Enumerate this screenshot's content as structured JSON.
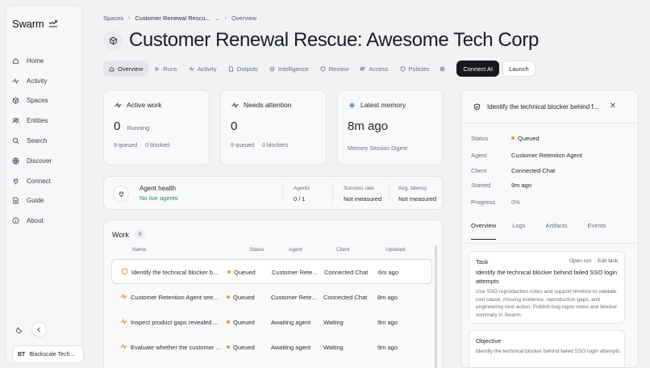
{
  "sidebar": {
    "brand": "Swarm",
    "items": [
      {
        "label": "Home",
        "icon": "home-icon"
      },
      {
        "label": "Activity",
        "icon": "activity-icon"
      },
      {
        "label": "Spaces",
        "icon": "cube-icon"
      },
      {
        "label": "Entities",
        "icon": "users-icon"
      },
      {
        "label": "Search",
        "icon": "search-icon"
      },
      {
        "label": "Discover",
        "icon": "globe-icon"
      },
      {
        "label": "Connect",
        "icon": "plug-icon"
      },
      {
        "label": "Guide",
        "icon": "document-icon"
      },
      {
        "label": "About",
        "icon": "info-icon"
      }
    ],
    "org_initials": "BT",
    "org_name": "Blackscale Tech..."
  },
  "breadcrumb": {
    "root": "Spaces",
    "space": "Customer Renewal Rescu...",
    "current": "Overview"
  },
  "page": {
    "title": "Customer Renewal Rescue: Awesome Tech Corp"
  },
  "tabs": {
    "items": [
      "Overview",
      "Runs",
      "Activity",
      "Outputs",
      "Intelligence",
      "Review",
      "Access",
      "Policies"
    ],
    "connect_ai": "Connect AI",
    "launch": "Launch"
  },
  "stats": {
    "active_work": {
      "title": "Active work",
      "value": "0",
      "sub": "Running",
      "queued": "9 queued",
      "blocked": "0 blocked"
    },
    "needs_attention": {
      "title": "Needs attention",
      "value": "0",
      "queued": "9 queued",
      "blockers": "0 blockers"
    },
    "latest_memory": {
      "title": "Latest memory",
      "value": "8m ago",
      "sub": "Memory Session Digest"
    }
  },
  "health": {
    "title": "Agent health",
    "status": "No live agents",
    "agents_label": "Agents",
    "agents_value": "0 / 1",
    "success_label": "Success rate",
    "success_value": "Not measured",
    "latency_label": "Avg. latency",
    "latency_value": "Not measured"
  },
  "work": {
    "title": "Work",
    "count": "9",
    "columns": {
      "name": "Name",
      "status": "Status",
      "agent": "Agent",
      "client": "Client",
      "updated": "Updated"
    },
    "rows": [
      {
        "name": "Identify the technical blocker b...",
        "status": "Queued",
        "agent": "Customer Rete...",
        "client": "Connected Chat",
        "updated": "6m ago"
      },
      {
        "name": "Customer Retention Agent see...",
        "status": "Queued",
        "agent": "Customer Rete...",
        "client": "Connected Chat",
        "updated": "8m ago"
      },
      {
        "name": "Inspect product gaps revealed ...",
        "status": "Queued",
        "agent": "Awaiting agent",
        "client": "Waiting",
        "updated": "9m ago"
      },
      {
        "name": "Evaluate whether the customer ...",
        "status": "Queued",
        "agent": "Awaiting agent",
        "client": "Waiting",
        "updated": "9m ago"
      }
    ]
  },
  "detail": {
    "title": "Identify the technical blocker behind f...",
    "status_label": "Status",
    "status_value": "Queued",
    "agent_label": "Agent",
    "agent_value": "Customer Retention Agent",
    "client_label": "Client",
    "client_value": "Connected Chat",
    "started_label": "Started",
    "started_value": "9m ago",
    "progress_label": "Progress",
    "progress_value": "0%",
    "tabs": [
      "Overview",
      "Logs",
      "Artifacts",
      "Events"
    ],
    "task_label": "Task",
    "open_run": "Open run",
    "edit_task": "Edit task",
    "task_title": "Identify the technical blocker behind failed SSO login attempts",
    "task_desc": "Use SSO reproduction notes and support timeline to validate root cause, missing evidence, reproduction gaps, and engineering next action. Publish bug-repro notes and blocker summary in Swarm.",
    "objective_label": "Objective",
    "objective_desc": "Identify the technical blocker behind failed SSO login attempts"
  },
  "colors": {
    "accent_dark": "#16181b",
    "queued": "#f0962e",
    "health_green": "#2f8a55"
  }
}
